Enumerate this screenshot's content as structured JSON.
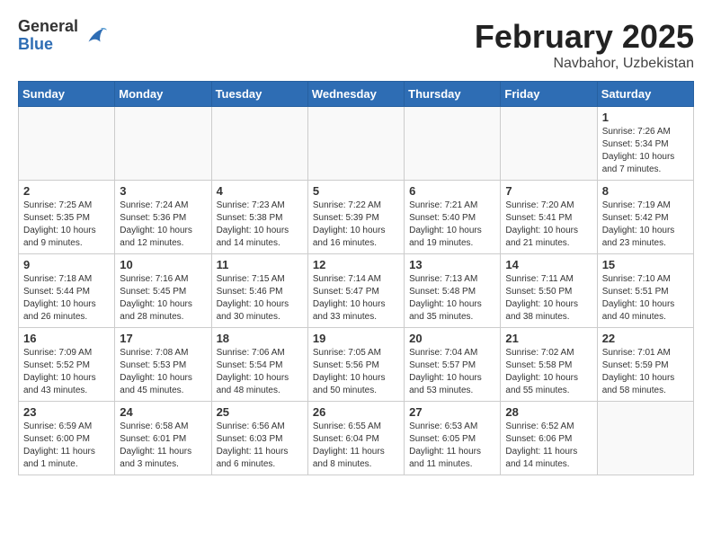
{
  "header": {
    "logo_general": "General",
    "logo_blue": "Blue",
    "month_title": "February 2025",
    "location": "Navbahor, Uzbekistan"
  },
  "weekdays": [
    "Sunday",
    "Monday",
    "Tuesday",
    "Wednesday",
    "Thursday",
    "Friday",
    "Saturday"
  ],
  "weeks": [
    [
      {
        "day": "",
        "info": ""
      },
      {
        "day": "",
        "info": ""
      },
      {
        "day": "",
        "info": ""
      },
      {
        "day": "",
        "info": ""
      },
      {
        "day": "",
        "info": ""
      },
      {
        "day": "",
        "info": ""
      },
      {
        "day": "1",
        "info": "Sunrise: 7:26 AM\nSunset: 5:34 PM\nDaylight: 10 hours and 7 minutes."
      }
    ],
    [
      {
        "day": "2",
        "info": "Sunrise: 7:25 AM\nSunset: 5:35 PM\nDaylight: 10 hours and 9 minutes."
      },
      {
        "day": "3",
        "info": "Sunrise: 7:24 AM\nSunset: 5:36 PM\nDaylight: 10 hours and 12 minutes."
      },
      {
        "day": "4",
        "info": "Sunrise: 7:23 AM\nSunset: 5:38 PM\nDaylight: 10 hours and 14 minutes."
      },
      {
        "day": "5",
        "info": "Sunrise: 7:22 AM\nSunset: 5:39 PM\nDaylight: 10 hours and 16 minutes."
      },
      {
        "day": "6",
        "info": "Sunrise: 7:21 AM\nSunset: 5:40 PM\nDaylight: 10 hours and 19 minutes."
      },
      {
        "day": "7",
        "info": "Sunrise: 7:20 AM\nSunset: 5:41 PM\nDaylight: 10 hours and 21 minutes."
      },
      {
        "day": "8",
        "info": "Sunrise: 7:19 AM\nSunset: 5:42 PM\nDaylight: 10 hours and 23 minutes."
      }
    ],
    [
      {
        "day": "9",
        "info": "Sunrise: 7:18 AM\nSunset: 5:44 PM\nDaylight: 10 hours and 26 minutes."
      },
      {
        "day": "10",
        "info": "Sunrise: 7:16 AM\nSunset: 5:45 PM\nDaylight: 10 hours and 28 minutes."
      },
      {
        "day": "11",
        "info": "Sunrise: 7:15 AM\nSunset: 5:46 PM\nDaylight: 10 hours and 30 minutes."
      },
      {
        "day": "12",
        "info": "Sunrise: 7:14 AM\nSunset: 5:47 PM\nDaylight: 10 hours and 33 minutes."
      },
      {
        "day": "13",
        "info": "Sunrise: 7:13 AM\nSunset: 5:48 PM\nDaylight: 10 hours and 35 minutes."
      },
      {
        "day": "14",
        "info": "Sunrise: 7:11 AM\nSunset: 5:50 PM\nDaylight: 10 hours and 38 minutes."
      },
      {
        "day": "15",
        "info": "Sunrise: 7:10 AM\nSunset: 5:51 PM\nDaylight: 10 hours and 40 minutes."
      }
    ],
    [
      {
        "day": "16",
        "info": "Sunrise: 7:09 AM\nSunset: 5:52 PM\nDaylight: 10 hours and 43 minutes."
      },
      {
        "day": "17",
        "info": "Sunrise: 7:08 AM\nSunset: 5:53 PM\nDaylight: 10 hours and 45 minutes."
      },
      {
        "day": "18",
        "info": "Sunrise: 7:06 AM\nSunset: 5:54 PM\nDaylight: 10 hours and 48 minutes."
      },
      {
        "day": "19",
        "info": "Sunrise: 7:05 AM\nSunset: 5:56 PM\nDaylight: 10 hours and 50 minutes."
      },
      {
        "day": "20",
        "info": "Sunrise: 7:04 AM\nSunset: 5:57 PM\nDaylight: 10 hours and 53 minutes."
      },
      {
        "day": "21",
        "info": "Sunrise: 7:02 AM\nSunset: 5:58 PM\nDaylight: 10 hours and 55 minutes."
      },
      {
        "day": "22",
        "info": "Sunrise: 7:01 AM\nSunset: 5:59 PM\nDaylight: 10 hours and 58 minutes."
      }
    ],
    [
      {
        "day": "23",
        "info": "Sunrise: 6:59 AM\nSunset: 6:00 PM\nDaylight: 11 hours and 1 minute."
      },
      {
        "day": "24",
        "info": "Sunrise: 6:58 AM\nSunset: 6:01 PM\nDaylight: 11 hours and 3 minutes."
      },
      {
        "day": "25",
        "info": "Sunrise: 6:56 AM\nSunset: 6:03 PM\nDaylight: 11 hours and 6 minutes."
      },
      {
        "day": "26",
        "info": "Sunrise: 6:55 AM\nSunset: 6:04 PM\nDaylight: 11 hours and 8 minutes."
      },
      {
        "day": "27",
        "info": "Sunrise: 6:53 AM\nSunset: 6:05 PM\nDaylight: 11 hours and 11 minutes."
      },
      {
        "day": "28",
        "info": "Sunrise: 6:52 AM\nSunset: 6:06 PM\nDaylight: 11 hours and 14 minutes."
      },
      {
        "day": "",
        "info": ""
      }
    ]
  ]
}
